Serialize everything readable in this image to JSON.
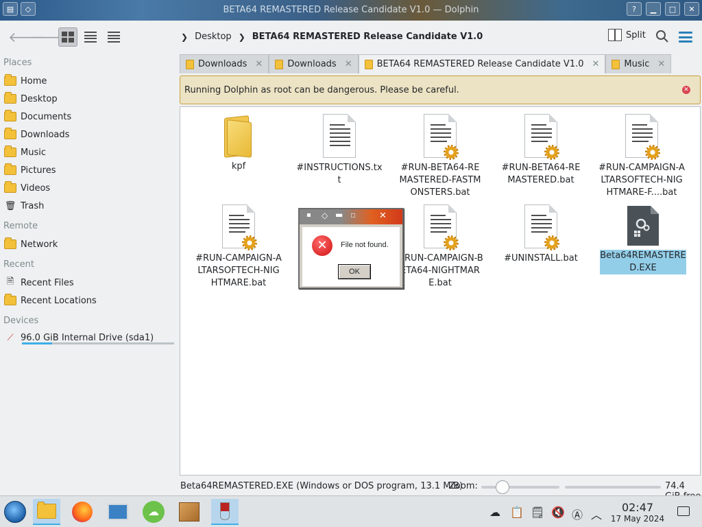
{
  "window": {
    "title": "BETA64 REMASTERED Release Candidate V1.0 — Dolphin"
  },
  "breadcrumb": {
    "items": [
      "Desktop",
      "BETA64 REMASTERED Release Candidate V1.0"
    ]
  },
  "toolbar": {
    "split_label": "Split"
  },
  "sidebar": {
    "places_title": "Places",
    "places": [
      "Home",
      "Desktop",
      "Documents",
      "Downloads",
      "Music",
      "Pictures",
      "Videos",
      "Trash"
    ],
    "remote_title": "Remote",
    "remote": [
      "Network"
    ],
    "recent_title": "Recent",
    "recent": [
      "Recent Files",
      "Recent Locations"
    ],
    "devices_title": "Devices",
    "devices": [
      "96.0 GiB Internal Drive (sda1)"
    ]
  },
  "tabs": [
    {
      "label": "Downloads"
    },
    {
      "label": "Downloads"
    },
    {
      "label": "BETA64 REMASTERED Release Candidate V1.0"
    },
    {
      "label": "Music"
    }
  ],
  "warning": {
    "text": "Running Dolphin as root can be dangerous. Please be careful."
  },
  "files": [
    {
      "name": "kpf",
      "type": "folder"
    },
    {
      "name": "#INSTRUCTIONS.txt",
      "type": "text"
    },
    {
      "name": "#RUN-BETA64-REMASTERED-FASTMONSTERS.bat",
      "type": "bat"
    },
    {
      "name": "#RUN-BETA64-REMASTERED.bat",
      "type": "bat"
    },
    {
      "name": "#RUN-CAMPAIGN-ALTARSOFTECH-NIGHTMARE-F....bat",
      "type": "bat"
    },
    {
      "name": "#RUN-CAMPAIGN-ALTARSOFTECH-NIGHTMARE.bat",
      "type": "bat"
    },
    {
      "name": "#RUN-CAMPAIGN-BETA64-NIGHTMARE.bat",
      "type": "bat"
    },
    {
      "name": "#UNINSTALL.bat",
      "type": "bat"
    },
    {
      "name": "Beta64REMASTERED.EXE",
      "type": "exe",
      "selected": true
    }
  ],
  "dialog": {
    "message": "File not found.",
    "ok_label": "OK"
  },
  "statusbar": {
    "text": "Beta64REMASTERED.EXE (Windows or DOS program, 13.1 MiB)",
    "zoom_label": "Zoom:",
    "free_space": "74.4 GiB free"
  },
  "taskbar": {
    "time": "02:47",
    "date": "17 May 2024"
  }
}
